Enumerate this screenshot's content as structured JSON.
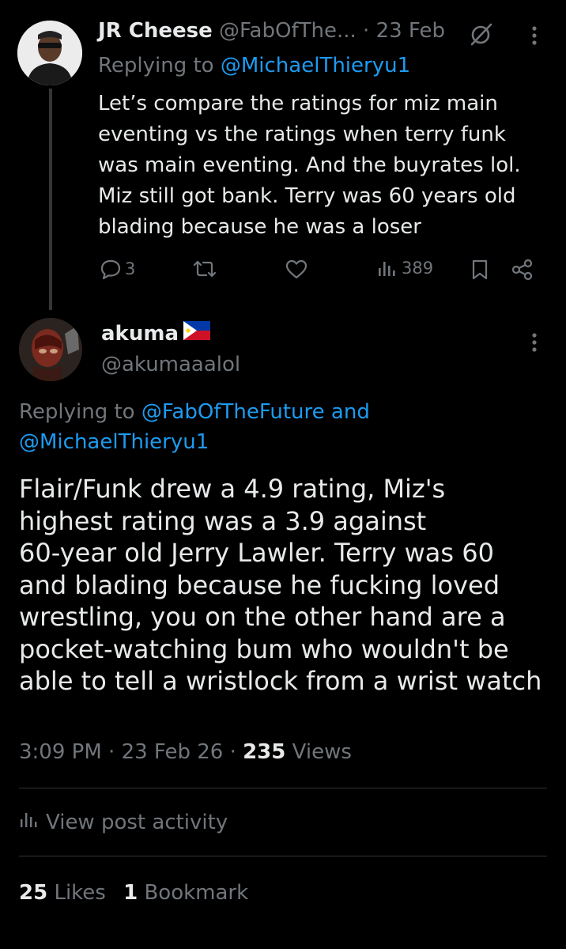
{
  "reply": {
    "author_name": "JR Cheese",
    "author_handle": "@FabOfThe...",
    "dot": "·",
    "date": "23 Feb",
    "replying_to_label": "Replying to",
    "replying_to_handle": "@MichaelThieryu1",
    "body_lines": [
      "Let’s compare the ratings for miz main",
      "eventing vs the ratings when terry funk",
      "was main eventing. And the buyrates lol.",
      "Miz still got bank. Terry was 60 years old",
      "blading because he was a loser"
    ],
    "reply_count": "3",
    "views_count": "389",
    "icons": [
      "reply-icon",
      "repost-icon",
      "like-icon",
      "views-icon",
      "bookmark-icon",
      "share-icon",
      "grok-icon",
      "more-icon"
    ]
  },
  "post": {
    "author_name": "akuma",
    "flag": "philippines-flag",
    "author_handle": "@akumaaalol",
    "replying_to_label": "Replying to",
    "replying_to_handle_1": "@FabOfTheFuture",
    "and": "and",
    "replying_to_handle_2": "@MichaelThieryu1",
    "body_lines": [
      "Flair/Funk drew a 4.9 rating, Miz's",
      "highest rating was a 3.9 against",
      "60-year old Jerry Lawler. Terry was 60",
      "and blading because he fucking loved",
      "wrestling, you on the other hand are a",
      "pocket-watching bum who wouldn't be",
      "able to tell a wristlock from a wrist watch"
    ],
    "time": "3:09 PM",
    "dot": "·",
    "date": "23 Feb 26",
    "views_count": "235",
    "views_label": "Views",
    "activity_label": "View post activity",
    "likes_count": "25",
    "likes_label": "Likes",
    "bookmarks_count": "1",
    "bookmarks_label": "Bookmark"
  },
  "colors": {
    "background": "#000000",
    "text": "#e7e9ea",
    "secondary": "#71767b",
    "link": "#1d9bf0",
    "divider": "#2f3336"
  }
}
